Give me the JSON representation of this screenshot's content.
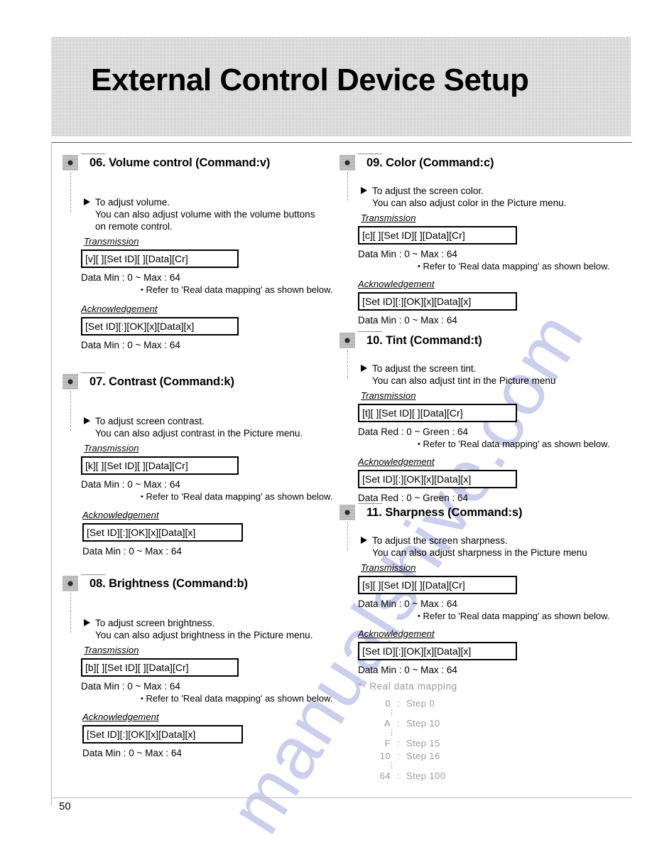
{
  "document": {
    "header_title": "External Control Device Setup",
    "page_number": "50",
    "watermark": "manualshive.com",
    "accent_gray": "#bdbdbd",
    "watermark_color": "#c9ccec"
  },
  "labels": {
    "transmission": "Transmission",
    "acknowledgement": "Acknowledgement",
    "refer_note": "Refer to 'Real data mapping' as shown below.",
    "data_prefix": "Data"
  },
  "sections": [
    {
      "id": "06",
      "title": "06. Volume control (Command:v)",
      "desc_line1": "To adjust volume.",
      "desc_line2": "You can also adjust volume with the volume buttons",
      "desc_line3": "on remote control.",
      "transmission_label": "Transmission",
      "transmission_code": "[v][ ][Set ID][ ][Data][Cr]",
      "transmission_data": "Data    Min : 0 ~ Max : 64",
      "refer": "Refer to 'Real data mapping' as shown below.",
      "ack_label": "Acknowledgement",
      "ack_code": "[Set ID][:][OK][x][Data][x]",
      "ack_data": "Data    Min : 0 ~ Max : 64"
    },
    {
      "id": "07",
      "title": "07. Contrast (Command:k)",
      "desc_line1": "To adjust screen contrast.",
      "desc_line2": "You can also adjust contrast in the Picture menu.",
      "desc_line3": "",
      "transmission_label": "Transmission",
      "transmission_code": "[k][ ][Set ID][ ][Data][Cr]",
      "transmission_data": "Data    Min : 0 ~ Max : 64",
      "refer": "Refer to 'Real data mapping' as shown below.",
      "ack_label": "Acknowledgement",
      "ack_code": "[Set ID][:][OK][x][Data][x]",
      "ack_data": "Data    Min : 0 ~ Max : 64"
    },
    {
      "id": "08",
      "title": "08. Brightness (Command:b)",
      "desc_line1": "To adjust screen brightness.",
      "desc_line2": "You can also adjust brightness in the Picture menu.",
      "desc_line3": "",
      "transmission_label": "Transmission",
      "transmission_code": "[b][ ][Set ID][ ][Data][Cr]",
      "transmission_data": "Data    Min : 0 ~ Max : 64",
      "refer": "Refer to 'Real data mapping' as shown below.",
      "ack_label": "Acknowledgement",
      "ack_code": "[Set ID][:][OK][x][Data][x]",
      "ack_data": "Data    Min : 0 ~ Max : 64"
    },
    {
      "id": "09",
      "title": "09. Color (Command:c)",
      "desc_line1": "To adjust the screen color.",
      "desc_line2": "You can also adjust color in the Picture menu.",
      "desc_line3": "",
      "transmission_label": "Transmission",
      "transmission_code": "[c][ ][Set ID][ ][Data][Cr]",
      "transmission_data": "Data    Min : 0 ~ Max : 64",
      "refer": "Refer to 'Real data mapping' as shown below.",
      "ack_label": "Acknowledgement",
      "ack_code": "[Set ID][:][OK][x][Data][x]",
      "ack_data": "Data    Min : 0 ~ Max : 64"
    },
    {
      "id": "10",
      "title": "10. Tint (Command:t)",
      "desc_line1": "To adjust the screen tint.",
      "desc_line2": "You can also adjust tint in the Picture menu",
      "desc_line3": "",
      "transmission_label": "Transmission",
      "transmission_code": "[t][ ][Set ID][ ][Data][Cr]",
      "transmission_data": "Data    Red : 0 ~ Green : 64",
      "refer": "Refer to 'Real data mapping' as shown below.",
      "ack_label": "Acknowledgement",
      "ack_code": "[Set ID][:][OK][x][Data][x]",
      "ack_data": "Data    Red : 0 ~ Green : 64"
    },
    {
      "id": "11",
      "title": "11. Sharpness (Command:s)",
      "desc_line1": "To adjust the screen sharpness.",
      "desc_line2": "You can also adjust sharpness in the Picture menu",
      "desc_line3": "",
      "transmission_label": "Transmission",
      "transmission_code": "[s][ ][Set ID][ ][Data][Cr]",
      "transmission_data": "Data    Min : 0 ~ Max : 64",
      "refer": "Refer to 'Real data mapping' as shown below.",
      "ack_label": "Acknowledgement",
      "ack_code": "[Set ID][:][OK][x][Data][x]",
      "ack_data": "Data    Min : 0 ~ Max : 64"
    }
  ],
  "real_data_mapping": {
    "title": "Real data mapping",
    "star": "*",
    "rows": [
      {
        "value": "0",
        "sep": ":",
        "step": "Step 0",
        "dots_after": true
      },
      {
        "value": "A",
        "sep": ":",
        "step": "Step 10",
        "dots_after": true
      },
      {
        "value": "F",
        "sep": ":",
        "step": "Step 15",
        "dots_after": false
      },
      {
        "value": "10",
        "sep": ":",
        "step": "Step 16",
        "dots_after": true
      },
      {
        "value": "64",
        "sep": ":",
        "step": "Step 100",
        "dots_after": false
      }
    ],
    "dots_glyph": "⋮"
  }
}
